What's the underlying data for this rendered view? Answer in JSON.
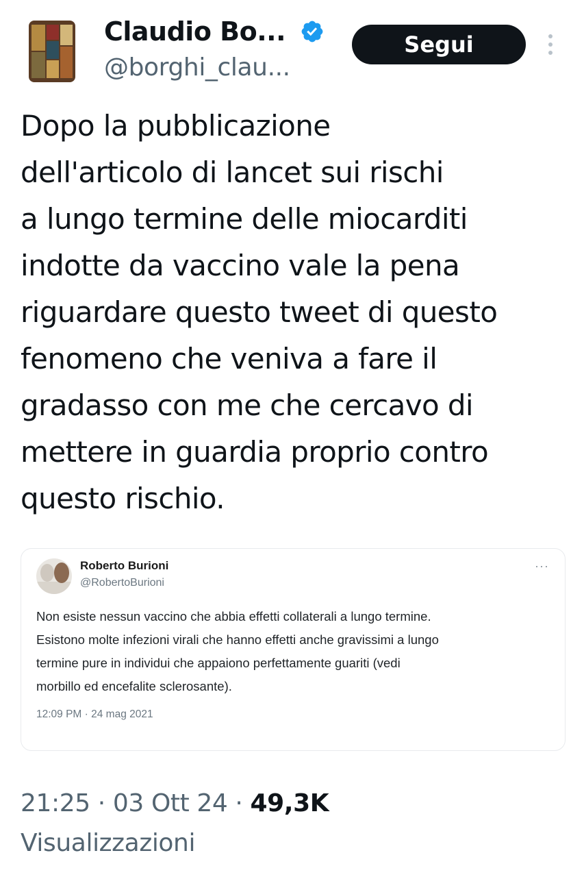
{
  "author": {
    "display_name": "Claudio Bo...",
    "handle": "@borghi_clau..."
  },
  "actions": {
    "follow_label": "Segui"
  },
  "tweet": {
    "lines": [
      "Dopo la pubblicazione",
      "dell'articolo di lancet sui rischi",
      "a lungo termine delle miocarditi",
      "indotte da vaccino vale la pena",
      "riguardare questo tweet di questo",
      "fenomeno che veniva a fare il",
      "gradasso con me che cercavo di",
      "mettere in guardia proprio contro",
      "questo rischio."
    ]
  },
  "quoted": {
    "display_name": "Roberto Burioni",
    "handle": "@RobertoBurioni",
    "more": "···",
    "lines": [
      "Non esiste nessun vaccino che abbia effetti collaterali a lungo termine.",
      "Esistono molte infezioni virali che hanno effetti anche gravissimi a lungo",
      "termine pure in individui che appaiono perfettamente guariti (vedi",
      "morbillo ed encefalite sclerosante)."
    ],
    "timestamp": "12:09 PM · 24 mag 2021"
  },
  "meta": {
    "time": "21:25",
    "separator": " · ",
    "date": "03 Ott 24",
    "views_count": "49,3K",
    "views_label": "Visualizzazioni"
  },
  "colors": {
    "verified_badge": "#1d9bf0",
    "follow_button_bg": "#0f1419",
    "secondary_text": "#536471"
  },
  "icons": {
    "verified": "verified-badge-icon",
    "more": "more-vertical-icon"
  }
}
